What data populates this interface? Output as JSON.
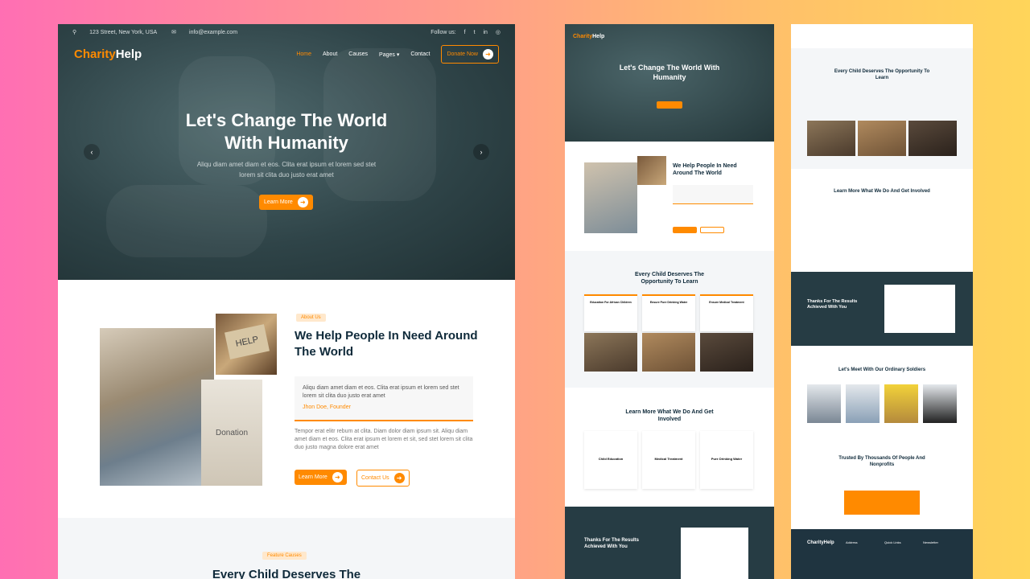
{
  "main": {
    "topbar": {
      "address": "123 Street, New York, USA",
      "email": "info@example.com",
      "follow": "Follow us:",
      "social": [
        "f",
        "t",
        "in",
        "◎"
      ]
    },
    "logo": {
      "part1": "Charity",
      "part2": "Help"
    },
    "nav": [
      "Home",
      "About",
      "Causes",
      "Pages ▾",
      "Contact"
    ],
    "donate": "Donate Now",
    "hero": {
      "title_line1": "Let's Change The World",
      "title_line2": "With Humanity",
      "sub_line1": "Aliqu diam amet diam et eos. Clita erat ipsum et lorem sed stet",
      "sub_line2": "lorem sit clita duo justo erat amet",
      "button": "Learn More"
    },
    "about": {
      "tag": "About Us",
      "title": "We Help People In Need Around The World",
      "quote": "Aliqu diam amet diam et eos. Clita erat ipsum et lorem sed stet lorem sit clita duo justo erat amet",
      "author": "Jhon Doe, Founder",
      "text": "Tempor erat elitr rebum at clita. Diam dolor diam ipsum sit. Aliqu diam amet diam et eos. Clita erat ipsum et lorem et sit, sed stet lorem sit clita duo justo magna dolore erat amet",
      "learn": "Learn More",
      "contact": "Contact Us",
      "img_sign": "Donation",
      "img_help": "HELP"
    },
    "feature": {
      "tag": "Feature Causes",
      "title": "Every Child Deserves The"
    }
  },
  "mid": {
    "logo": "CharityHelp",
    "hero_title": "Let's Change The World With Humanity",
    "about_title": "We Help People In Need Around The World",
    "causes_title": "Every Child Deserves The Opportunity To Learn",
    "causes": [
      "Education For African Children",
      "Ensure Pure Drinking Water",
      "Ensure Medical Treatment"
    ],
    "learn_title": "Learn More What We Do And Get Involved",
    "services": [
      "Child Education",
      "Medical Treatment",
      "Pure Drinking Water"
    ],
    "thanks_title": "Thanks For The Results Achieved With You",
    "donate_btn": "Donate Now"
  },
  "right": {
    "causes_title": "Every Child Deserves The Opportunity To Learn",
    "learn_title": "Learn More What We Do And Get Involved",
    "thanks_title": "Thanks For The Results Achieved With You",
    "team_title": "Let's Meet With Our Ordinary Soldiers",
    "trusted_title": "Trusted By Thousands Of People And Nonprofits",
    "footer_logo": "CharityHelp",
    "footer_cols": [
      "Address",
      "Quick Links",
      "Newsletter"
    ]
  },
  "colors": {
    "accent": "#ff8a00",
    "dark": "#263c44",
    "title": "#0f2a3a"
  }
}
